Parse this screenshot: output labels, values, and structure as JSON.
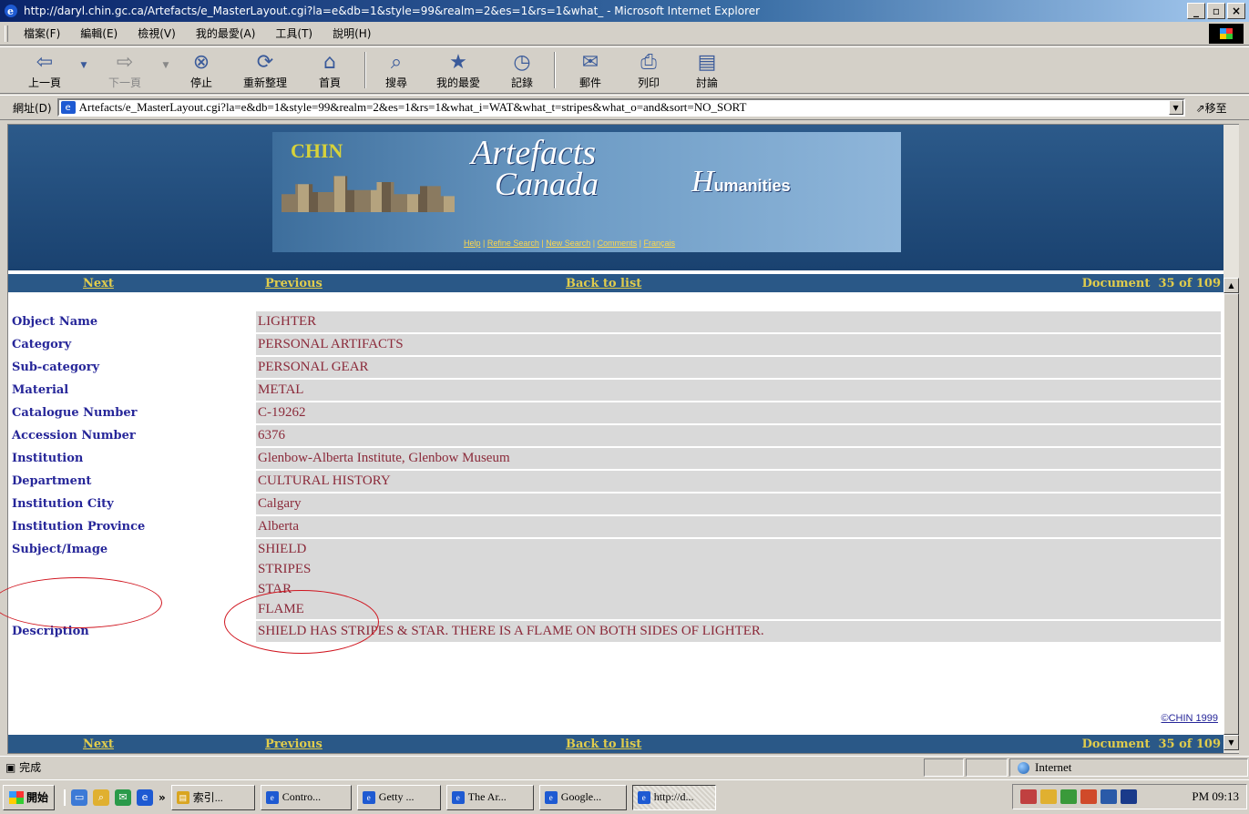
{
  "window": {
    "title": "http://daryl.chin.gc.ca/Artefacts/e_MasterLayout.cgi?la=e&db=1&style=99&realm=2&es=1&rs=1&what_ - Microsoft Internet Explorer",
    "min": "_",
    "max": "▫",
    "close": "×"
  },
  "menu": {
    "file": "檔案(F)",
    "edit": "編輯(E)",
    "view": "檢視(V)",
    "favorites": "我的最愛(A)",
    "tools": "工具(T)",
    "help": "說明(H)"
  },
  "toolbar": {
    "back": "上一頁",
    "forward": "下一頁",
    "stop": "停止",
    "refresh": "重新整理",
    "home": "首頁",
    "search": "搜尋",
    "favorites": "我的最愛",
    "history": "記錄",
    "mail": "郵件",
    "print": "列印",
    "discuss": "討論"
  },
  "address": {
    "label": "網址(D)",
    "url": "Artefacts/e_MasterLayout.cgi?la=e&db=1&style=99&realm=2&es=1&rs=1&what_i=WAT&what_t=stripes&what_o=and&sort=NO_SORT",
    "go": "移至"
  },
  "banner": {
    "chin": "CHIN",
    "artefacts": "Artefacts",
    "canada": "Canada",
    "humanities_h": "H",
    "humanities_rest": "umanities",
    "links": {
      "help": "Help",
      "refine": "Refine Search",
      "new": "New Search",
      "comments": "Comments",
      "francais": "Français"
    }
  },
  "nav": {
    "next": "Next",
    "previous": "Previous",
    "back": "Back to list",
    "document": "Document",
    "current": "35",
    "of": "of",
    "total": "109"
  },
  "record": [
    {
      "label": "Object Name",
      "value": "LIGHTER"
    },
    {
      "label": "Category",
      "value": "PERSONAL ARTIFACTS"
    },
    {
      "label": "Sub-category",
      "value": "PERSONAL GEAR"
    },
    {
      "label": "Material",
      "value": "METAL"
    },
    {
      "label": "Catalogue Number",
      "value": "C-19262"
    },
    {
      "label": "Accession Number",
      "value": "6376"
    },
    {
      "label": "Institution",
      "value": "Glenbow-Alberta Institute, Glenbow Museum"
    },
    {
      "label": "Department",
      "value": "CULTURAL HISTORY"
    },
    {
      "label": "Institution City",
      "value": "Calgary"
    },
    {
      "label": "Institution Province",
      "value": "Alberta"
    }
  ],
  "subject": {
    "label": "Subject/Image",
    "values": [
      "SHIELD",
      "STRIPES",
      "STAR",
      "FLAME"
    ]
  },
  "description": {
    "label": "Description",
    "value": "SHIELD HAS STRIPES & STAR. THERE IS A FLAME ON BOTH SIDES OF LIGHTER."
  },
  "copyright": "©CHIN 1999",
  "status": {
    "text": "完成",
    "zone": "Internet"
  },
  "taskbar": {
    "start": "開始",
    "chevron": "»",
    "tasks": [
      "索引...",
      "Contro...",
      "Getty ...",
      "The Ar...",
      "Google...",
      "http://d..."
    ],
    "clock": "PM 09:13"
  },
  "colors": {
    "label": "#262699",
    "value": "#8b2a3a",
    "nav_bg": "#2a5887",
    "nav_text": "#e0cc4c",
    "annotation": "#d0141e"
  }
}
